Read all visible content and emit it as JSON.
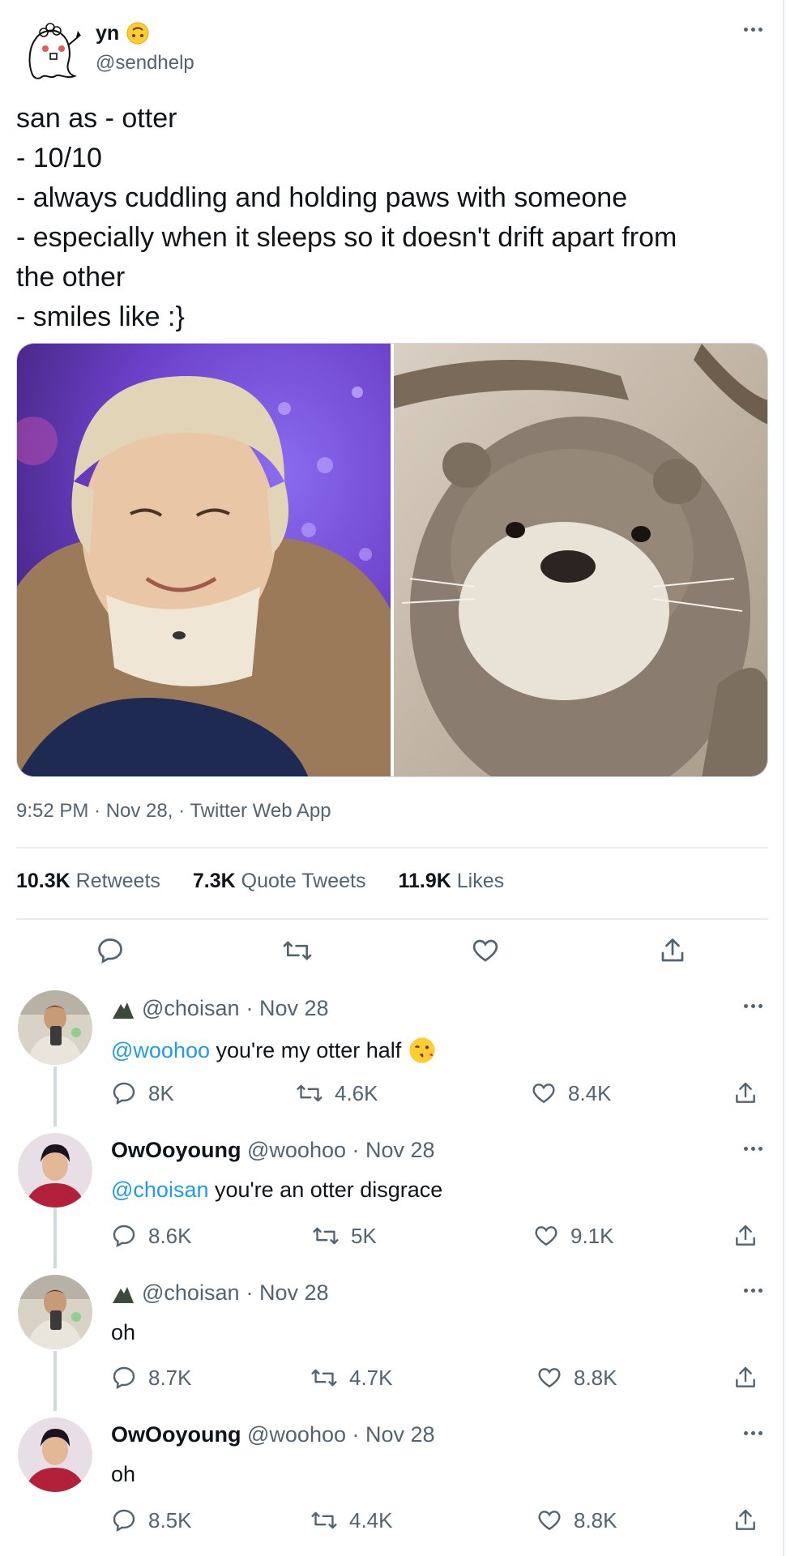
{
  "tweet": {
    "display_name": "yn",
    "handle": "@sendhelp",
    "lines": [
      "san as - otter",
      "- 10/10",
      "- always cuddling and holding paws with someone",
      "- especially when it sleeps so it doesn't drift apart from",
      "the other",
      "- smiles like :}"
    ],
    "timestamp": "9:52 PM · Nov 28, · Twitter Web App",
    "retweets_count": "10.3K",
    "retweets_label": "Retweets",
    "quotes_count": "7.3K",
    "quotes_label": "Quote Tweets",
    "likes_count": "11.9K",
    "likes_label": "Likes"
  },
  "replies": [
    {
      "name": "",
      "handle": "@choisan",
      "date": "· Nov 28",
      "mention": "@woohoo",
      "text": " you're my otter half",
      "reply_count": "8K",
      "retweet_count": "4.6K",
      "like_count": "8.4K"
    },
    {
      "name": "OwOoyoung",
      "handle": "@woohoo",
      "date": "· Nov 28",
      "mention": "@choisan",
      "text": " you're an otter disgrace",
      "reply_count": "8.6K",
      "retweet_count": "5K",
      "like_count": "9.1K"
    },
    {
      "name": "",
      "handle": "@choisan",
      "date": "· Nov 28",
      "mention": "",
      "text": "oh",
      "reply_count": "8.7K",
      "retweet_count": "4.7K",
      "like_count": "8.8K"
    },
    {
      "name": "OwOoyoung",
      "handle": "@woohoo",
      "date": "· Nov 28",
      "mention": "",
      "text": "oh",
      "reply_count": "8.5K",
      "retweet_count": "4.4K",
      "like_count": "8.8K"
    }
  ],
  "colors": {
    "link": "#1d9bf0",
    "muted": "#536471",
    "text": "#0f1419"
  },
  "icons": [
    "more-icon",
    "reply-icon",
    "retweet-icon",
    "like-icon",
    "share-icon",
    "upside-down-face-emoji",
    "kiss-emoji",
    "mountain-icon"
  ]
}
